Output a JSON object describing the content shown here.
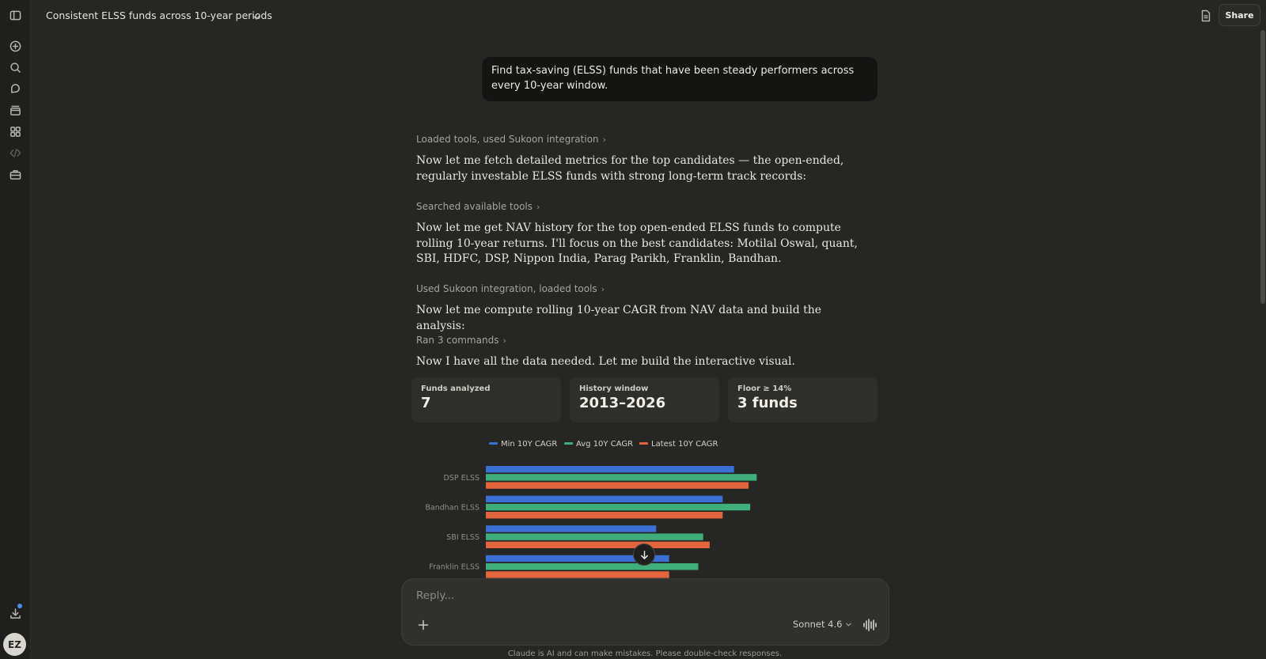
{
  "header": {
    "conversation_title": "Consistent ELSS funds across 10-year periods",
    "share_label": "Share"
  },
  "sidebar": {
    "icons": [
      "sidebar-toggle-icon",
      "new-chat-icon",
      "search-icon",
      "chats-icon",
      "projects-icon",
      "artifacts-icon",
      "code-icon",
      "toolbox-icon"
    ],
    "download_icon": "download-icon",
    "avatar_initials": "EZ"
  },
  "user_message": "Find tax-saving (ELSS) funds that have been steady performers across every 10-year window.",
  "steps": [
    {
      "tool": "Loaded tools, used Sukoon integration",
      "text": "Now let me fetch detailed metrics for the top candidates — the open-ended, regularly investable ELSS funds with strong long-term track records:"
    },
    {
      "tool": "Searched available tools",
      "text": "Now let me get NAV history for the top open-ended ELSS funds to compute rolling 10-year returns. I'll focus on the best candidates: Motilal Oswal, quant, SBI, HDFC, DSP, Nippon India, Parag Parikh, Franklin, Bandhan."
    },
    {
      "tool": "Used Sukoon integration, loaded tools",
      "text": "Now let me compute rolling 10-year CAGR from NAV data and build the analysis:"
    },
    {
      "tool": "Ran 3 commands",
      "text": "Now I have all the data needed. Let me build the interactive visual."
    }
  ],
  "stats": [
    {
      "label": "Funds analyzed",
      "value": "7"
    },
    {
      "label": "History window",
      "value": "2013–2026"
    },
    {
      "label": "Floor ≥ 14%",
      "value": "3 funds"
    }
  ],
  "chart_data": {
    "type": "bar",
    "orientation": "horizontal",
    "categories": [
      "DSP ELSS",
      "Bandhan ELSS",
      "SBI ELSS",
      "Franklin ELSS"
    ],
    "series": [
      {
        "name": "Min 10Y CAGR",
        "color": "#3b6fd4",
        "values": [
          15.3,
          14.6,
          10.5,
          11.3
        ]
      },
      {
        "name": "Avg 10Y CAGR",
        "color": "#3fae7a",
        "values": [
          16.7,
          16.3,
          13.4,
          13.1
        ]
      },
      {
        "name": "Latest 10Y CAGR",
        "color": "#e2653e",
        "values": [
          16.2,
          14.6,
          13.8,
          11.3
        ]
      }
    ],
    "xlim": [
      0,
      20
    ],
    "legend_position": "top",
    "grid": false
  },
  "composer": {
    "placeholder": "Reply...",
    "model": "Sonnet 4.6",
    "disclaimer": "Claude is AI and can make mistakes. Please double-check responses."
  }
}
